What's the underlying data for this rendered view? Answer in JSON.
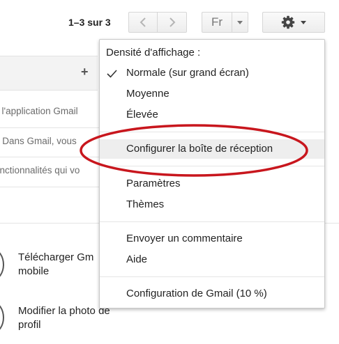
{
  "toolbar": {
    "pager_text": "1–3 sur 3",
    "language_label": "Fr",
    "prev_icon": "chevron-left-icon",
    "next_icon": "chevron-right-icon",
    "settings_icon": "gear-icon"
  },
  "background": {
    "snippets": [
      "z l'application Gmail",
      "e Dans Gmail, vous",
      "onctionnalités qui vo"
    ],
    "rows": [
      {
        "line1": "Télécharger Gm",
        "line2": "mobile"
      },
      {
        "line1": "Modifier la photo de",
        "line2": "profil"
      }
    ]
  },
  "menu": {
    "heading": "Densité d'affichage :",
    "density_options": [
      {
        "label": "Normale (sur grand écran)",
        "checked": true
      },
      {
        "label": "Moyenne",
        "checked": false
      },
      {
        "label": "Élevée",
        "checked": false
      }
    ],
    "configure_inbox": "Configurer la boîte de réception",
    "settings": "Paramètres",
    "themes": "Thèmes",
    "feedback": "Envoyer un commentaire",
    "help": "Aide",
    "gmail_setup": "Configuration de Gmail (10 %)"
  },
  "colors": {
    "annotation_ellipse": "#c8161d",
    "highlight": "#eeeeee"
  }
}
